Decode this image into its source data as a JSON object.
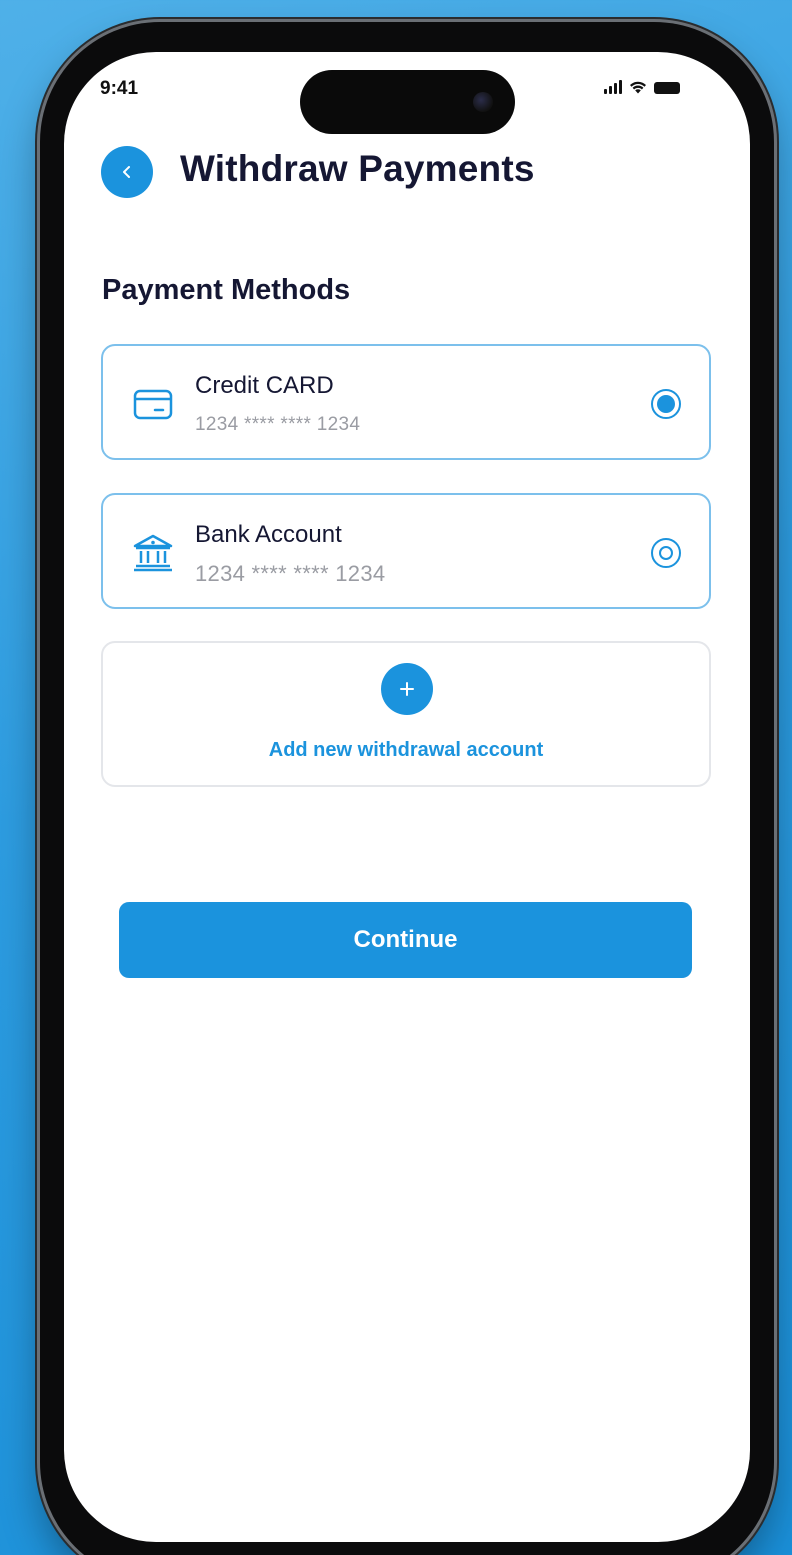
{
  "status_bar": {
    "time": "9:41"
  },
  "header": {
    "title": "Withdraw Payments",
    "back_icon": "chevron-left-icon"
  },
  "section": {
    "title": "Payment Methods"
  },
  "payment_methods": [
    {
      "name": "Credit CARD",
      "number": "1234 **** **** 1234",
      "icon": "credit-card-icon",
      "selected": true
    },
    {
      "name": "Bank Account",
      "number": "1234 **** **** 1234",
      "icon": "bank-icon",
      "selected": false
    }
  ],
  "add_account": {
    "icon": "plus-icon",
    "label": "Add new withdrawal account"
  },
  "actions": {
    "continue_label": "Continue"
  },
  "colors": {
    "accent": "#1b93dd",
    "title_text": "#151733",
    "muted_text": "#9a9ca3",
    "background_gradient_start": "#4fb0e8",
    "background_gradient_end": "#1a8fd8"
  }
}
